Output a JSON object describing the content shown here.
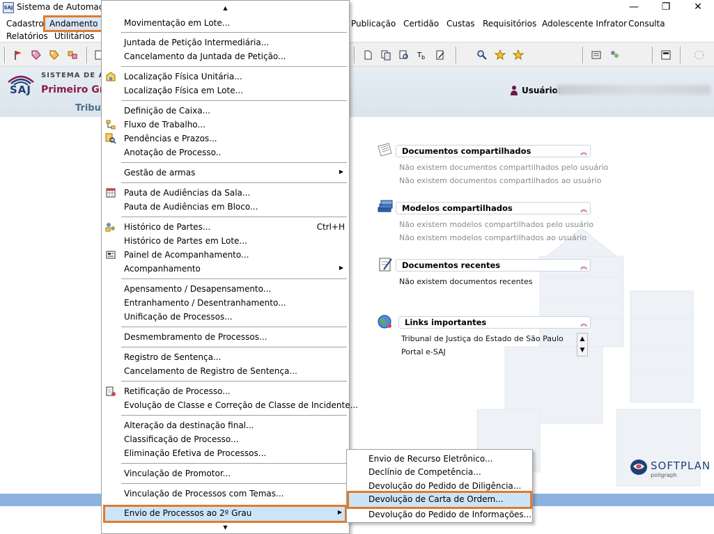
{
  "window": {
    "title": "Sistema de Automação",
    "app_icon_text": "SAJ",
    "minimize_glyph": "—",
    "maximize_glyph": "❐",
    "close_glyph": "✕"
  },
  "menubar": {
    "row1": [
      "Cadastro",
      "Andamento",
      "Publicação",
      "Certidão",
      "Custas",
      "Requisitórios",
      "Adolescente Infrator",
      "Consulta"
    ],
    "row2": [
      "Relatórios",
      "Utilitários"
    ]
  },
  "header": {
    "logo_text": "SAJ",
    "system_label": "SISTEMA DE AUT",
    "grau_label": "Primeiro Gra",
    "tribunal_label": "Tribu",
    "user_label": "Usuário:"
  },
  "panels": [
    {
      "title": "Documentos compartilhados",
      "icon": "documents-icon",
      "lines": [
        "Não existem documentos compartilhados pelo usuário",
        "Não existem documentos compartilhados ao usuário"
      ]
    },
    {
      "title": "Modelos compartilhados",
      "icon": "models-icon",
      "lines": [
        "Não existem modelos compartilhados pelo usuário",
        "Não existem modelos compartilhados ao usuário"
      ]
    },
    {
      "title": "Documentos recentes",
      "icon": "recent-documents-icon",
      "lines": [
        "Não existem documentos recentes"
      ]
    },
    {
      "title": "Links importantes",
      "icon": "globe-links-icon",
      "lines": [
        "Tribunal de Justiça do Estado de São Paulo",
        "Portal e-SAJ"
      ]
    }
  ],
  "collapse_glyph": "︽",
  "softplan": {
    "name": "SOFTPLAN",
    "sub": "poligraph"
  },
  "dropdown": {
    "scroll_up": "▲",
    "scroll_down": "▼",
    "items": [
      {
        "label": "Movimentação em Lote...",
        "icon": ""
      },
      {
        "label": "Juntada de Petição Intermediária...",
        "icon": ""
      },
      {
        "label": "Cancelamento da Juntada de Petição...",
        "icon": ""
      },
      {
        "label": "Localização Física Unitária...",
        "icon": "location-icon"
      },
      {
        "label": "Localização Física em Lote...",
        "icon": ""
      },
      {
        "label": "Definição de Caixa...",
        "icon": ""
      },
      {
        "label": "Fluxo de Trabalho...",
        "icon": "workflow-icon"
      },
      {
        "label": "Pendências e Prazos...",
        "icon": "pending-search-icon"
      },
      {
        "label": "Anotação de Processo..",
        "icon": ""
      },
      {
        "label": "Gestão de armas",
        "icon": "",
        "submenu": true
      },
      {
        "label": "Pauta de Audiências da Sala...",
        "icon": "calendar-icon"
      },
      {
        "label": "Pauta de Audiências em Bloco...",
        "icon": ""
      },
      {
        "label": "Histórico de Partes...",
        "icon": "parties-history-icon",
        "shortcut": "Ctrl+H"
      },
      {
        "label": "Histórico de Partes em Lote...",
        "icon": ""
      },
      {
        "label": "Painel de Acompanhamento...",
        "icon": "panel-icon"
      },
      {
        "label": "Acompanhamento",
        "icon": "",
        "submenu": true
      },
      {
        "label": "Apensamento / Desapensamento...",
        "icon": ""
      },
      {
        "label": "Entranhamento / Desentranhamento...",
        "icon": ""
      },
      {
        "label": "Unificação de Processos...",
        "icon": ""
      },
      {
        "label": "Desmembramento de Processos...",
        "icon": ""
      },
      {
        "label": "Registro de Sentença...",
        "icon": ""
      },
      {
        "label": "Cancelamento de Registro de Sentença...",
        "icon": ""
      },
      {
        "label": "Retificação de Processo...",
        "icon": "rectify-icon"
      },
      {
        "label": "Evolução de Classe e Correção de Classe de Incidente...",
        "icon": ""
      },
      {
        "label": "Alteração da destinação final...",
        "icon": ""
      },
      {
        "label": "Classificação de Processo...",
        "icon": ""
      },
      {
        "label": "Eliminação Efetiva de Processos...",
        "icon": ""
      },
      {
        "label": "Vinculação de Promotor...",
        "icon": ""
      },
      {
        "label": "Vinculação de Processos com Temas...",
        "icon": ""
      },
      {
        "label": "Envio de Processos ao 2º Grau",
        "icon": "",
        "submenu": true
      }
    ],
    "arrow_glyph": "▶"
  },
  "submenu": {
    "items": [
      "Envio de Recurso Eletrônico...",
      "Declínio de Competência...",
      "Devolução do Pedido de Diligência...",
      "Devolução de Carta de Ordem...",
      "Devolução do Pedido de Informações..."
    ]
  },
  "colors": {
    "highlight_border": "#e07b2a",
    "highlight_fill": "#cce4f7",
    "brand_blue": "#1f3f73",
    "brand_wine": "#8b1a4a",
    "bottom_bar": "#8db2e0"
  }
}
